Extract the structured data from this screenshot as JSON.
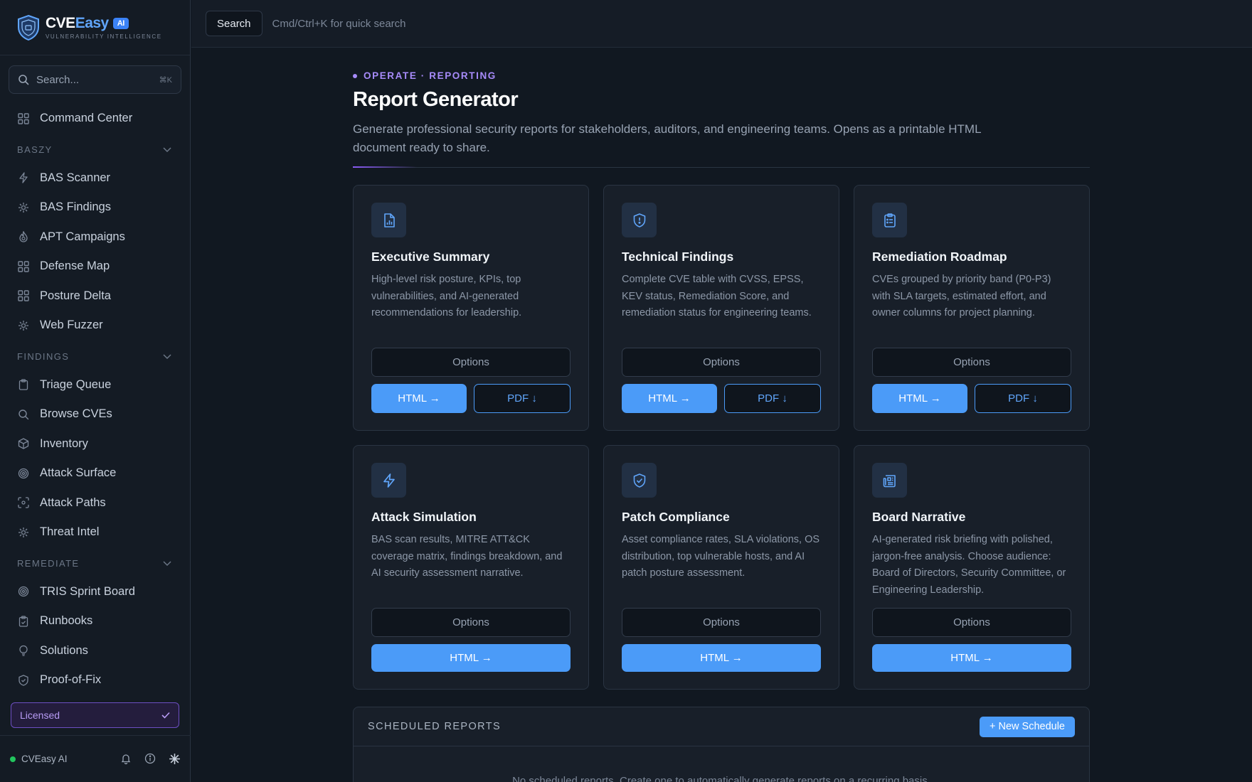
{
  "brand": {
    "name_part1": "CVE",
    "name_part2": "asy",
    "badge": "AI",
    "subtitle": "VULNERABILITY INTELLIGENCE"
  },
  "sidebar": {
    "search_placeholder": "Search...",
    "search_shortcut": "⌘K",
    "top_item": {
      "label": "Command Center",
      "icon": "grid-icon"
    },
    "sections": [
      {
        "title": "BASZY",
        "items": [
          {
            "label": "BAS Scanner",
            "icon": "bolt-icon"
          },
          {
            "label": "BAS Findings",
            "icon": "bug-icon"
          },
          {
            "label": "APT Campaigns",
            "icon": "flame-icon"
          },
          {
            "label": "Defense Map",
            "icon": "grid-icon"
          },
          {
            "label": "Posture Delta",
            "icon": "grid-icon"
          },
          {
            "label": "Web Fuzzer",
            "icon": "bug-icon"
          }
        ]
      },
      {
        "title": "FINDINGS",
        "items": [
          {
            "label": "Triage Queue",
            "icon": "clipboard-icon"
          },
          {
            "label": "Browse CVEs",
            "icon": "search-icon"
          },
          {
            "label": "Inventory",
            "icon": "cube-icon"
          },
          {
            "label": "Attack Surface",
            "icon": "target-icon"
          },
          {
            "label": "Attack Paths",
            "icon": "scan-icon"
          },
          {
            "label": "Threat Intel",
            "icon": "bug-icon"
          }
        ]
      },
      {
        "title": "REMEDIATE",
        "items": [
          {
            "label": "TRIS Sprint Board",
            "icon": "target-icon"
          },
          {
            "label": "Runbooks",
            "icon": "clipboard-check-icon"
          },
          {
            "label": "Solutions",
            "icon": "bulb-icon"
          },
          {
            "label": "Proof-of-Fix",
            "icon": "shield-check-icon"
          }
        ]
      }
    ],
    "license_label": "Licensed",
    "footer_label": "CVEasy AI"
  },
  "topbar": {
    "search_button": "Search",
    "hint": "Cmd/Ctrl+K for quick search"
  },
  "page": {
    "eyebrow": "OPERATE · REPORTING",
    "title": "Report Generator",
    "description": "Generate professional security reports for stakeholders, auditors, and engineering teams. Opens as a printable HTML document ready to share."
  },
  "labels": {
    "options": "Options",
    "html": "HTML →",
    "pdf": "PDF ↓"
  },
  "reports": [
    {
      "title": "Executive Summary",
      "icon": "doc-chart-icon",
      "description": "High-level risk posture, KPIs, top vulnerabilities, and AI-generated recommendations for leadership."
    },
    {
      "title": "Technical Findings",
      "icon": "shield-alert-icon",
      "description": "Complete CVE table with CVSS, EPSS, KEV status, Remediation Score, and remediation status for engineering teams."
    },
    {
      "title": "Remediation Roadmap",
      "icon": "clipboard-list-icon",
      "description": "CVEs grouped by priority band (P0-P3) with SLA targets, estimated effort, and owner columns for project planning."
    },
    {
      "title": "Attack Simulation",
      "icon": "bolt-icon",
      "description": "BAS scan results, MITRE ATT&CK coverage matrix, findings breakdown, and AI security assessment narrative."
    },
    {
      "title": "Patch Compliance",
      "icon": "shield-check-icon",
      "description": "Asset compliance rates, SLA violations, OS distribution, top vulnerable hosts, and AI patch posture assessment."
    },
    {
      "title": "Board Narrative",
      "icon": "newspaper-icon",
      "description": "AI-generated risk briefing with polished, jargon-free analysis. Choose audience: Board of Directors, Security Committee, or Engineering Leadership."
    }
  ],
  "scheduled": {
    "title": "SCHEDULED REPORTS",
    "new_button": "+ New Schedule",
    "empty_text": "No scheduled reports. Create one to automatically generate reports on a recurring basis."
  },
  "colors": {
    "accent": "#4b9bf8",
    "purple": "#a78bfa",
    "background": "#111821",
    "card": "#181f29",
    "status_green": "#22c55e"
  }
}
